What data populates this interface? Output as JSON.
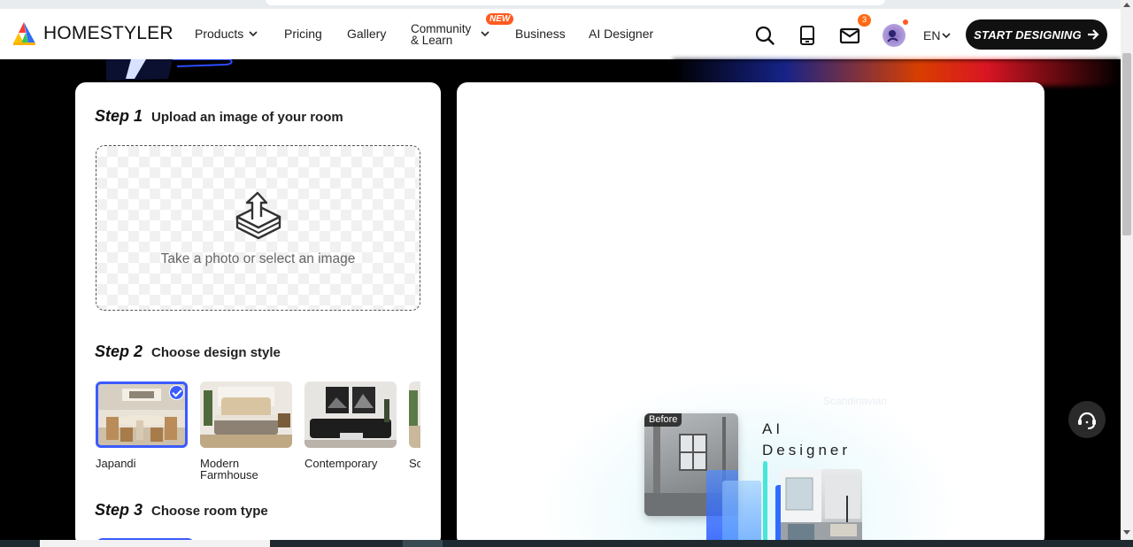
{
  "brand": {
    "name": "HOMESTYLER"
  },
  "nav": {
    "products": "Products",
    "pricing": "Pricing",
    "gallery": "Gallery",
    "community_line1": "Community",
    "community_line2": "& Learn",
    "new_badge": "NEW",
    "business": "Business",
    "ai_designer": "AI Designer"
  },
  "header": {
    "mail_count": "3",
    "language": "EN",
    "start_button": "START DESIGNING"
  },
  "step1": {
    "num": "Step 1",
    "label": "Upload an image of your room",
    "upload_text": "Take a photo or select an image"
  },
  "step2": {
    "num": "Step 2",
    "label": "Choose design style",
    "styles": [
      {
        "name": "Japandi",
        "selected": true
      },
      {
        "name": "Modern Farmhouse",
        "selected": false
      },
      {
        "name": "Contemporary",
        "selected": false
      },
      {
        "name": "Sc",
        "selected": false
      }
    ]
  },
  "step3": {
    "num": "Step 3",
    "label": "Choose room type"
  },
  "preview": {
    "before_label": "Before",
    "ai_line1": "AI",
    "ai_line2": "Designer",
    "faded_style": "Scandinavian"
  },
  "colors": {
    "accent": "#3b5bff",
    "badge": "#ff5a1f",
    "dark": "#111111"
  }
}
